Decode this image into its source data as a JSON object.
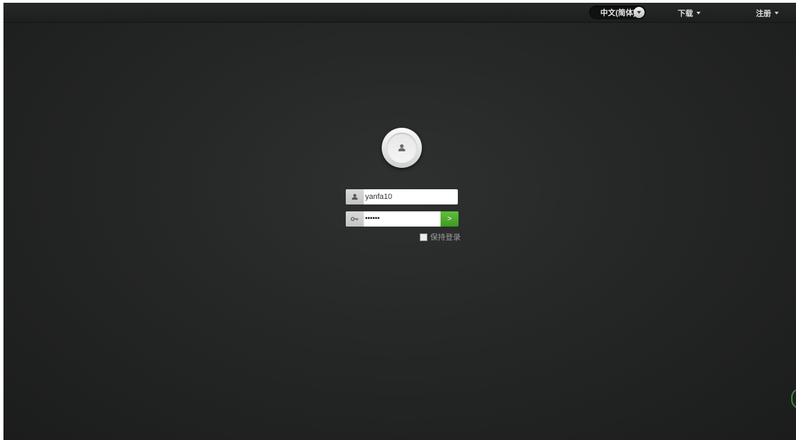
{
  "topbar": {
    "language": "中文(简体)",
    "download_label": "下载",
    "register_label": "注册"
  },
  "login": {
    "username": "yanfa10",
    "password_mask": "••••••",
    "submit_symbol": ">",
    "remember_label": "保持登录"
  },
  "colors": {
    "background": "#262827",
    "submit_green": "#4caf2f"
  },
  "icons": {
    "avatar": "user-icon",
    "username_prefix": "user-icon",
    "password_prefix": "key-icon",
    "language_dropdown": "chevron-down-icon"
  }
}
